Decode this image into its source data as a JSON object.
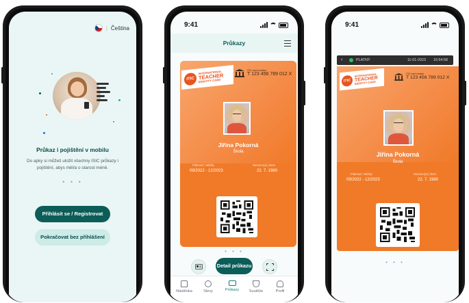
{
  "colors": {
    "brand_teal": "#0c5c58",
    "card_orange": "#f07a28",
    "logo_red": "#e8541e",
    "valid_green": "#22c55e"
  },
  "onboarding": {
    "language_flag_icon": "czech-flag-icon",
    "language_label": "Čeština",
    "title": "Průkaz i pojištění v mobilu",
    "description": "Do apky si můžeš uložit všechny ISIC průkazy i pojištění, abys měl/a o starost méně.",
    "pager_dots": "• • •",
    "login_button": "Přihlásit se / Registrovat",
    "continue_button": "Pokračovat bez přihlášení"
  },
  "status_bar": {
    "time": "9:41"
  },
  "cards_screen": {
    "title": "Průkazy",
    "filter_icon": "sliders-icon",
    "pager_dots": "• • •",
    "detail_button": "Detail průkazu",
    "tabs": [
      {
        "label": "Nástěnka",
        "icon": "home-icon"
      },
      {
        "label": "Slevy",
        "icon": "discount-icon"
      },
      {
        "label": "Průkazy",
        "icon": "card-icon"
      },
      {
        "label": "Soutěže",
        "icon": "trophy-icon"
      },
      {
        "label": "Profil",
        "icon": "user-icon"
      }
    ],
    "active_tab": "Průkazy"
  },
  "card": {
    "logo_abbr": "ITIC",
    "logo_line1": "INTERNATIONAL",
    "logo_line2": "TEACHER",
    "logo_line3": "IDENTITY CARD",
    "card_number_label": "ITIC card number",
    "card_number": "T 123 456 789 012 X",
    "holder_name": "Jiřina Pokorná",
    "school": "Škola",
    "validity_label": "Platnost | Validity",
    "validity_value": "09/2022 - 12/2023",
    "birth_label": "Narozen(a) | Born",
    "birth_value": "22. 7. 1980"
  },
  "detail_screen": {
    "status": "PLATNÝ",
    "date": "11-01-2023",
    "time": "16:54:58",
    "pager_dots": "• • •"
  }
}
